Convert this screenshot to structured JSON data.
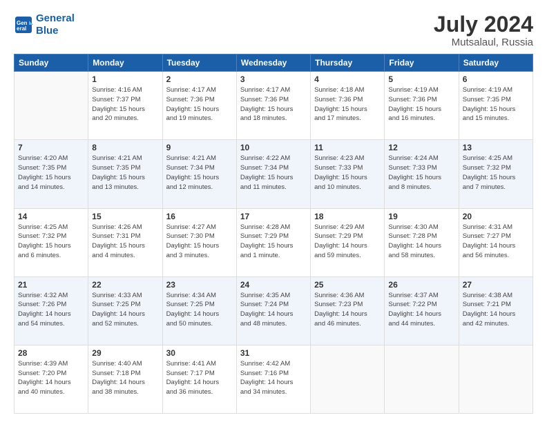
{
  "header": {
    "logo_line1": "General",
    "logo_line2": "Blue",
    "month_year": "July 2024",
    "location": "Mutsalaul, Russia"
  },
  "weekdays": [
    "Sunday",
    "Monday",
    "Tuesday",
    "Wednesday",
    "Thursday",
    "Friday",
    "Saturday"
  ],
  "weeks": [
    [
      {
        "day": "",
        "detail": ""
      },
      {
        "day": "1",
        "detail": "Sunrise: 4:16 AM\nSunset: 7:37 PM\nDaylight: 15 hours\nand 20 minutes."
      },
      {
        "day": "2",
        "detail": "Sunrise: 4:17 AM\nSunset: 7:36 PM\nDaylight: 15 hours\nand 19 minutes."
      },
      {
        "day": "3",
        "detail": "Sunrise: 4:17 AM\nSunset: 7:36 PM\nDaylight: 15 hours\nand 18 minutes."
      },
      {
        "day": "4",
        "detail": "Sunrise: 4:18 AM\nSunset: 7:36 PM\nDaylight: 15 hours\nand 17 minutes."
      },
      {
        "day": "5",
        "detail": "Sunrise: 4:19 AM\nSunset: 7:36 PM\nDaylight: 15 hours\nand 16 minutes."
      },
      {
        "day": "6",
        "detail": "Sunrise: 4:19 AM\nSunset: 7:35 PM\nDaylight: 15 hours\nand 15 minutes."
      }
    ],
    [
      {
        "day": "7",
        "detail": "Sunrise: 4:20 AM\nSunset: 7:35 PM\nDaylight: 15 hours\nand 14 minutes."
      },
      {
        "day": "8",
        "detail": "Sunrise: 4:21 AM\nSunset: 7:35 PM\nDaylight: 15 hours\nand 13 minutes."
      },
      {
        "day": "9",
        "detail": "Sunrise: 4:21 AM\nSunset: 7:34 PM\nDaylight: 15 hours\nand 12 minutes."
      },
      {
        "day": "10",
        "detail": "Sunrise: 4:22 AM\nSunset: 7:34 PM\nDaylight: 15 hours\nand 11 minutes."
      },
      {
        "day": "11",
        "detail": "Sunrise: 4:23 AM\nSunset: 7:33 PM\nDaylight: 15 hours\nand 10 minutes."
      },
      {
        "day": "12",
        "detail": "Sunrise: 4:24 AM\nSunset: 7:33 PM\nDaylight: 15 hours\nand 8 minutes."
      },
      {
        "day": "13",
        "detail": "Sunrise: 4:25 AM\nSunset: 7:32 PM\nDaylight: 15 hours\nand 7 minutes."
      }
    ],
    [
      {
        "day": "14",
        "detail": "Sunrise: 4:25 AM\nSunset: 7:32 PM\nDaylight: 15 hours\nand 6 minutes."
      },
      {
        "day": "15",
        "detail": "Sunrise: 4:26 AM\nSunset: 7:31 PM\nDaylight: 15 hours\nand 4 minutes."
      },
      {
        "day": "16",
        "detail": "Sunrise: 4:27 AM\nSunset: 7:30 PM\nDaylight: 15 hours\nand 3 minutes."
      },
      {
        "day": "17",
        "detail": "Sunrise: 4:28 AM\nSunset: 7:29 PM\nDaylight: 15 hours\nand 1 minute."
      },
      {
        "day": "18",
        "detail": "Sunrise: 4:29 AM\nSunset: 7:29 PM\nDaylight: 14 hours\nand 59 minutes."
      },
      {
        "day": "19",
        "detail": "Sunrise: 4:30 AM\nSunset: 7:28 PM\nDaylight: 14 hours\nand 58 minutes."
      },
      {
        "day": "20",
        "detail": "Sunrise: 4:31 AM\nSunset: 7:27 PM\nDaylight: 14 hours\nand 56 minutes."
      }
    ],
    [
      {
        "day": "21",
        "detail": "Sunrise: 4:32 AM\nSunset: 7:26 PM\nDaylight: 14 hours\nand 54 minutes."
      },
      {
        "day": "22",
        "detail": "Sunrise: 4:33 AM\nSunset: 7:25 PM\nDaylight: 14 hours\nand 52 minutes."
      },
      {
        "day": "23",
        "detail": "Sunrise: 4:34 AM\nSunset: 7:25 PM\nDaylight: 14 hours\nand 50 minutes."
      },
      {
        "day": "24",
        "detail": "Sunrise: 4:35 AM\nSunset: 7:24 PM\nDaylight: 14 hours\nand 48 minutes."
      },
      {
        "day": "25",
        "detail": "Sunrise: 4:36 AM\nSunset: 7:23 PM\nDaylight: 14 hours\nand 46 minutes."
      },
      {
        "day": "26",
        "detail": "Sunrise: 4:37 AM\nSunset: 7:22 PM\nDaylight: 14 hours\nand 44 minutes."
      },
      {
        "day": "27",
        "detail": "Sunrise: 4:38 AM\nSunset: 7:21 PM\nDaylight: 14 hours\nand 42 minutes."
      }
    ],
    [
      {
        "day": "28",
        "detail": "Sunrise: 4:39 AM\nSunset: 7:20 PM\nDaylight: 14 hours\nand 40 minutes."
      },
      {
        "day": "29",
        "detail": "Sunrise: 4:40 AM\nSunset: 7:18 PM\nDaylight: 14 hours\nand 38 minutes."
      },
      {
        "day": "30",
        "detail": "Sunrise: 4:41 AM\nSunset: 7:17 PM\nDaylight: 14 hours\nand 36 minutes."
      },
      {
        "day": "31",
        "detail": "Sunrise: 4:42 AM\nSunset: 7:16 PM\nDaylight: 14 hours\nand 34 minutes."
      },
      {
        "day": "",
        "detail": ""
      },
      {
        "day": "",
        "detail": ""
      },
      {
        "day": "",
        "detail": ""
      }
    ]
  ]
}
